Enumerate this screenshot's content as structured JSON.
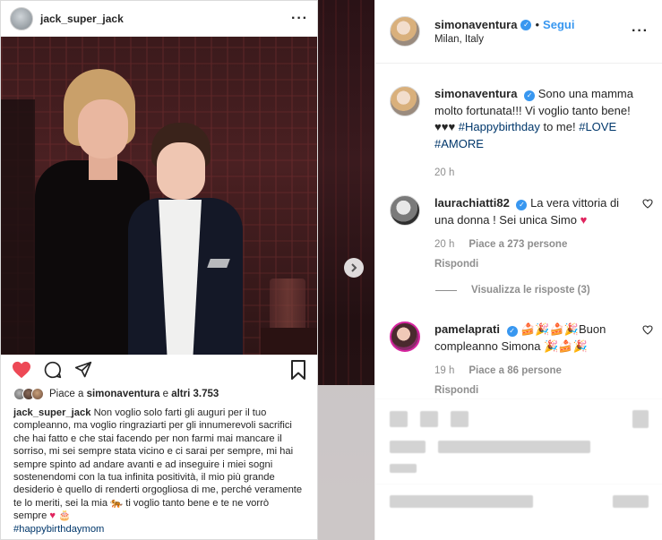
{
  "left_post": {
    "username": "jack_super_jack",
    "menu_icon": "more-horizontal-icon",
    "likes": {
      "prefix": "Piace a",
      "user": "simonaventura",
      "middle": "e",
      "count": "altri 3.753"
    },
    "caption": {
      "username": "jack_super_jack",
      "text": "Non voglio solo farti gli auguri per il tuo compleanno, ma voglio ringraziarti per gli innumerevoli sacrifici che hai fatto e che stai facendo per non farmi mai mancare il sorriso, mi sei sempre stata vicino e ci sarai per sempre, mi hai sempre spinto ad andare avanti e ad inseguire i miei sogni sostenendomi con la tua infinita positività, il mio più grande desiderio è quello di renderti orgogliosa di me, perché veramente te lo meriti, sei la mia 🐅 ti voglio tanto bene e te ne vorrò sempre",
      "emoji_end": "♥ 🎂",
      "hashtag": "#happybirthdaymom"
    }
  },
  "right_panel": {
    "header": {
      "username": "simonaventura",
      "bullet": "•",
      "follow": "Segui",
      "location": "Milan, Italy"
    },
    "main_comment": {
      "username": "simonaventura",
      "text_a": "Sono una mamma molto fortunata!!! Vi voglio tanto bene! ♥♥♥",
      "tag1": "#Happybirthday",
      "text_b": "to me!",
      "tag2": "#LOVE",
      "tag3": "#AMORE",
      "time": "20 h"
    },
    "comments": [
      {
        "username": "laurachiatti82",
        "text": "La vera vittoria di una donna ! Sei unica Simo",
        "emoji": "♥",
        "time": "20 h",
        "likes": "Piace a 273 persone",
        "reply": "Rispondi"
      },
      {
        "username": "pamelaprati",
        "text": "🍰🎉🍰🎉Buon compleanno Simona 🎉🍰🎉",
        "time": "19 h",
        "likes": "Piace a 86 persone",
        "reply": "Rispondi"
      }
    ],
    "view_replies": "Visualizza le risposte (3)"
  },
  "colors": {
    "accent": "#3897f0",
    "like_red": "#ed4956",
    "muted": "#8e8e8e",
    "text": "#262626"
  }
}
